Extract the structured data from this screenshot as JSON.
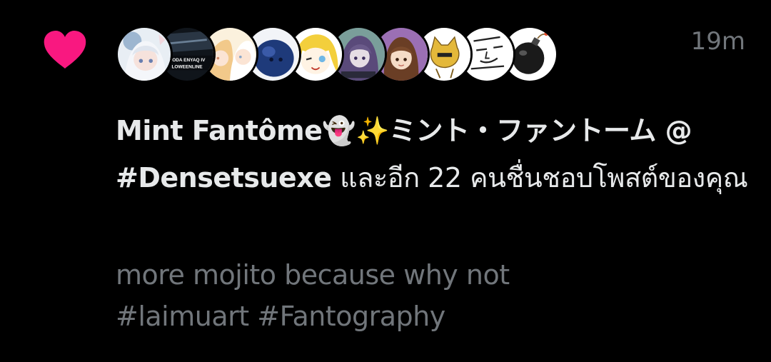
{
  "notification": {
    "timestamp": "19m",
    "heart_color": "#f91880",
    "avatars": [
      {
        "icon": "avatar-anime-girl-white-hair",
        "colors": [
          "#dfe6ee",
          "#9db6d0",
          "#f1d7dd"
        ]
      },
      {
        "icon": "avatar-car-banner",
        "banner_lines": [
          "KODA ENYAQ IV",
          "LOWEENLINE"
        ],
        "colors": [
          "#1a2027",
          "#3a4a5a"
        ]
      },
      {
        "icon": "avatar-anime-girls-pastel",
        "colors": [
          "#f6e6c6",
          "#f2c98a",
          "#ffffff"
        ]
      },
      {
        "icon": "avatar-blue-blob",
        "colors": [
          "#ffffff",
          "#1e3a7a",
          "#0d1f4a"
        ]
      },
      {
        "icon": "avatar-blonde-winking",
        "colors": [
          "#ffffff",
          "#f3cf3c",
          "#6fb7e6"
        ]
      },
      {
        "icon": "avatar-purple-hair-character",
        "colors": [
          "#7a9e9a",
          "#5a4a7a",
          "#d9d4dd"
        ]
      },
      {
        "icon": "avatar-brown-hair-girl",
        "colors": [
          "#9b6fb4",
          "#6a3e25",
          "#f5dcc6"
        ]
      },
      {
        "icon": "avatar-yellow-cat-sketch",
        "colors": [
          "#ffffff",
          "#e4b83a",
          "#7a5a1a"
        ]
      },
      {
        "icon": "avatar-doodle-face",
        "colors": [
          "#ffffff",
          "#222222"
        ]
      },
      {
        "icon": "avatar-bomb",
        "colors": [
          "#ffffff",
          "#1a1a1a",
          "#e84a2a"
        ]
      }
    ],
    "actor_name": "Mint Fantôme👻✨ミント・ファントーム @ #Densetsuexe",
    "action_text": " และอีก 22 คนชื่นชอบโพสต์ของคุณ",
    "post_lines": [
      "more mojito because why not",
      "#laimuart #Fantography"
    ]
  }
}
